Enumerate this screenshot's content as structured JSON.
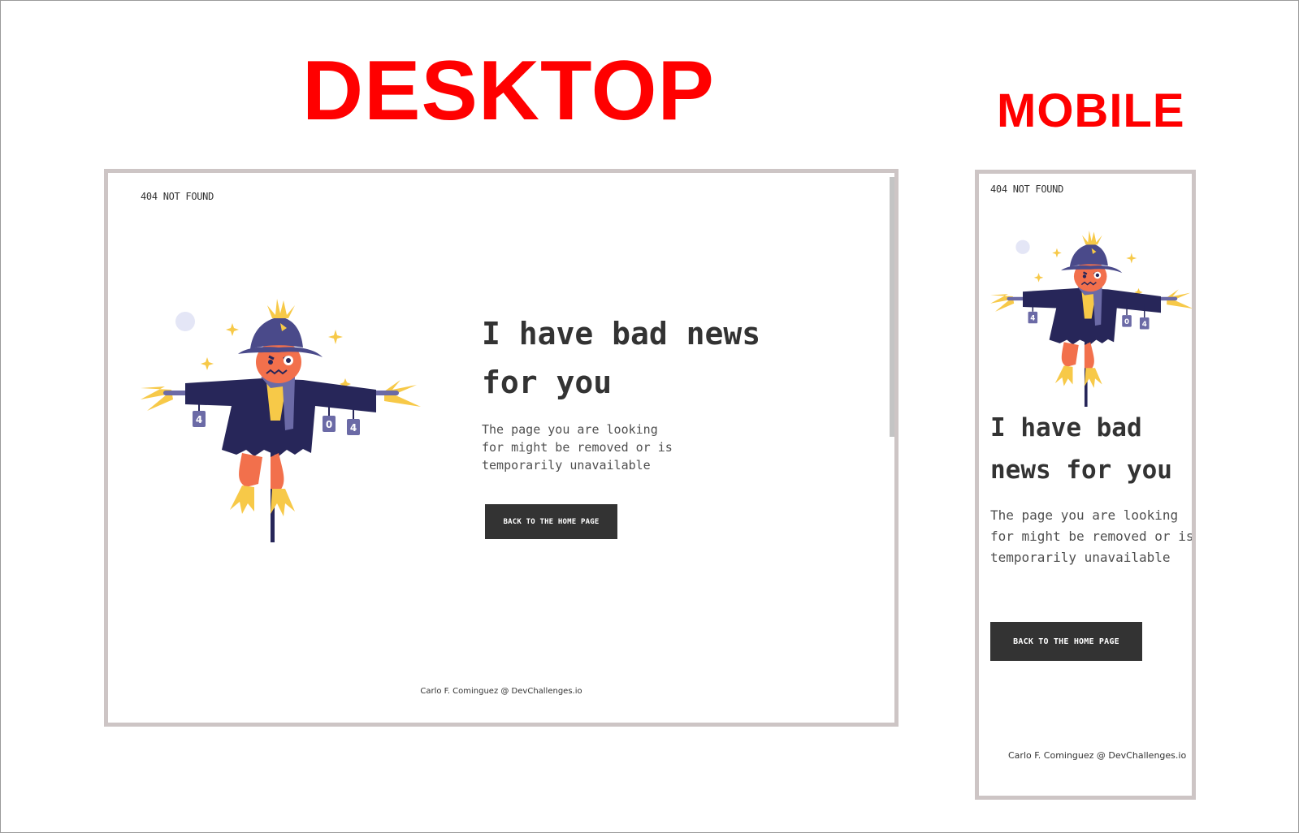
{
  "labels": {
    "desktop": "DESKTOP",
    "mobile": "MOBILE"
  },
  "page": {
    "brand": "404 NOT FOUND",
    "title": "I have bad news for you",
    "description": "The page you are looking for might be removed or is temporarily unavailable",
    "button_label": "BACK TO THE HOME PAGE",
    "footer": "Carlo F. Cominguez @ DevChallenges.io"
  },
  "colors": {
    "label_red": "#ff0000",
    "button_bg": "#333333",
    "frame_border": "#cdc5c5",
    "scarecrow_hat": "#4a4a8a",
    "scarecrow_coat": "#272659",
    "scarecrow_skin": "#f2704c",
    "straw": "#f7c948"
  },
  "illustration": {
    "can_labels": [
      "4",
      "0",
      "4"
    ]
  }
}
